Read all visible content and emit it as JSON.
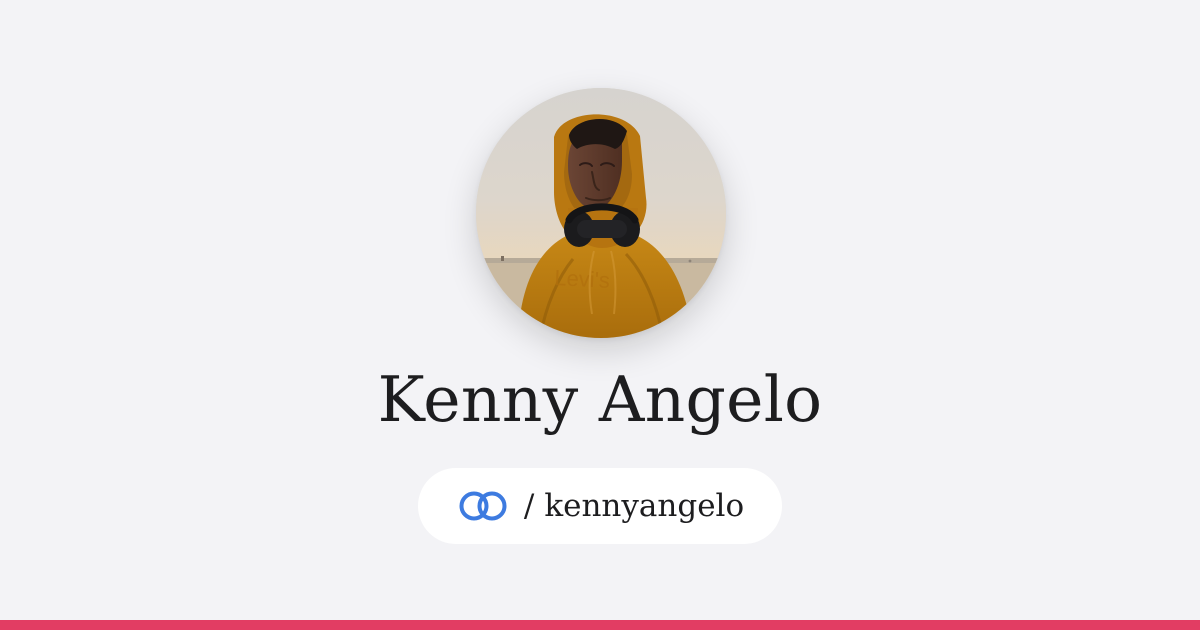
{
  "profile": {
    "name": "Kenny Angelo",
    "avatar_icon": "profile-photo"
  },
  "handle": {
    "separator": "/",
    "username": "kennyangelo",
    "icon": "linked-rings-icon"
  },
  "colors": {
    "background": "#f3f3f6",
    "brand_blue": "#3d7be0",
    "bottom_bar": "#e23d63",
    "text": "#1d1d1f"
  }
}
